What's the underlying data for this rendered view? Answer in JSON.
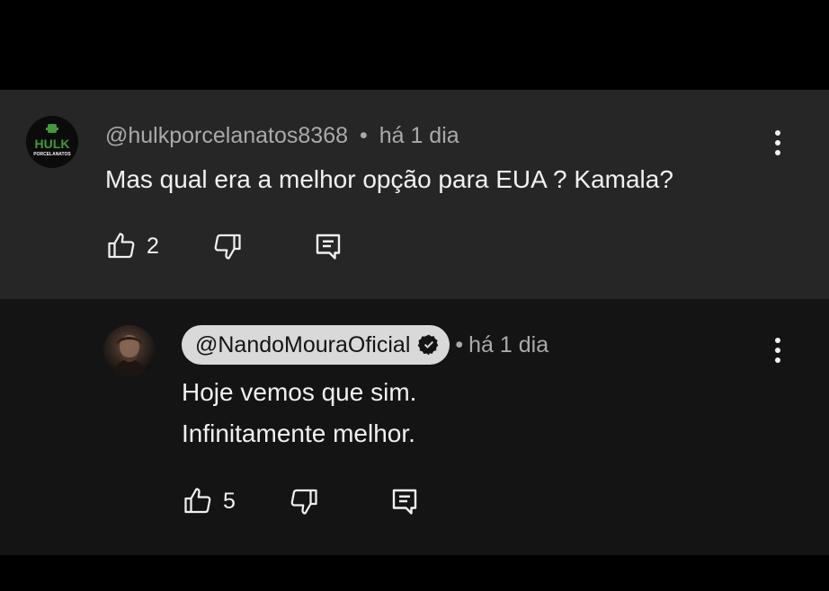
{
  "comments": [
    {
      "handle": "@hulkporcelanatos8368",
      "time": "há 1 dia",
      "separator": "•",
      "lines": [
        "Mas qual era a melhor opção para EUA ? Kamala?"
      ],
      "likes": "2",
      "avatar_text": {
        "top": "HULK",
        "bottom": "PORCELANATOS"
      }
    },
    {
      "handle": "@NandoMouraOficial",
      "verified": true,
      "time": "há 1 dia",
      "separator": "•",
      "lines": [
        "Hoje vemos que sim.",
        "Infinitamente melhor."
      ],
      "likes": "5"
    }
  ],
  "colors": {
    "hulk_green": "#3e9a3a",
    "meta_gray": "#aaaaaa",
    "chip_bg": "#d9d9d9"
  },
  "icons": [
    "like-icon",
    "dislike-icon",
    "reply-icon",
    "more-vertical-icon",
    "verified-badge-icon"
  ]
}
